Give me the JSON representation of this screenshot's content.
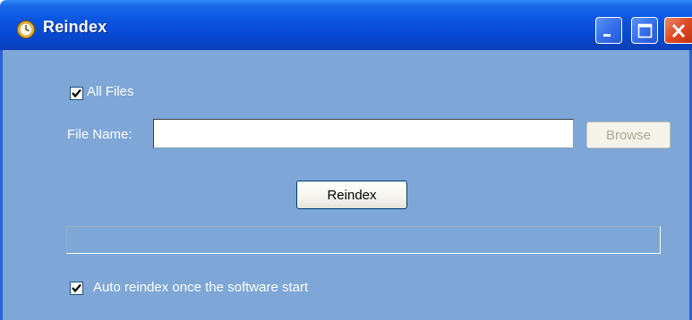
{
  "window": {
    "title": "Reindex",
    "app_icon": "clock-icon"
  },
  "titlebar_buttons": {
    "minimize": "minimize-icon",
    "maximize": "maximize-icon",
    "close": "close-icon"
  },
  "form": {
    "all_files_label": "All Files",
    "all_files_checked": true,
    "file_name_label": "File Name:",
    "file_name_value": "",
    "browse_label": "Browse",
    "browse_enabled": false,
    "reindex_label": "Reindex",
    "progress_fraction": 0,
    "auto_reindex_label": "Auto reindex once the software start",
    "auto_reindex_checked": true
  },
  "colors": {
    "titlebar": "#0a54e0",
    "client_bg": "#7ea6d6",
    "close_button": "#dd4b25"
  }
}
